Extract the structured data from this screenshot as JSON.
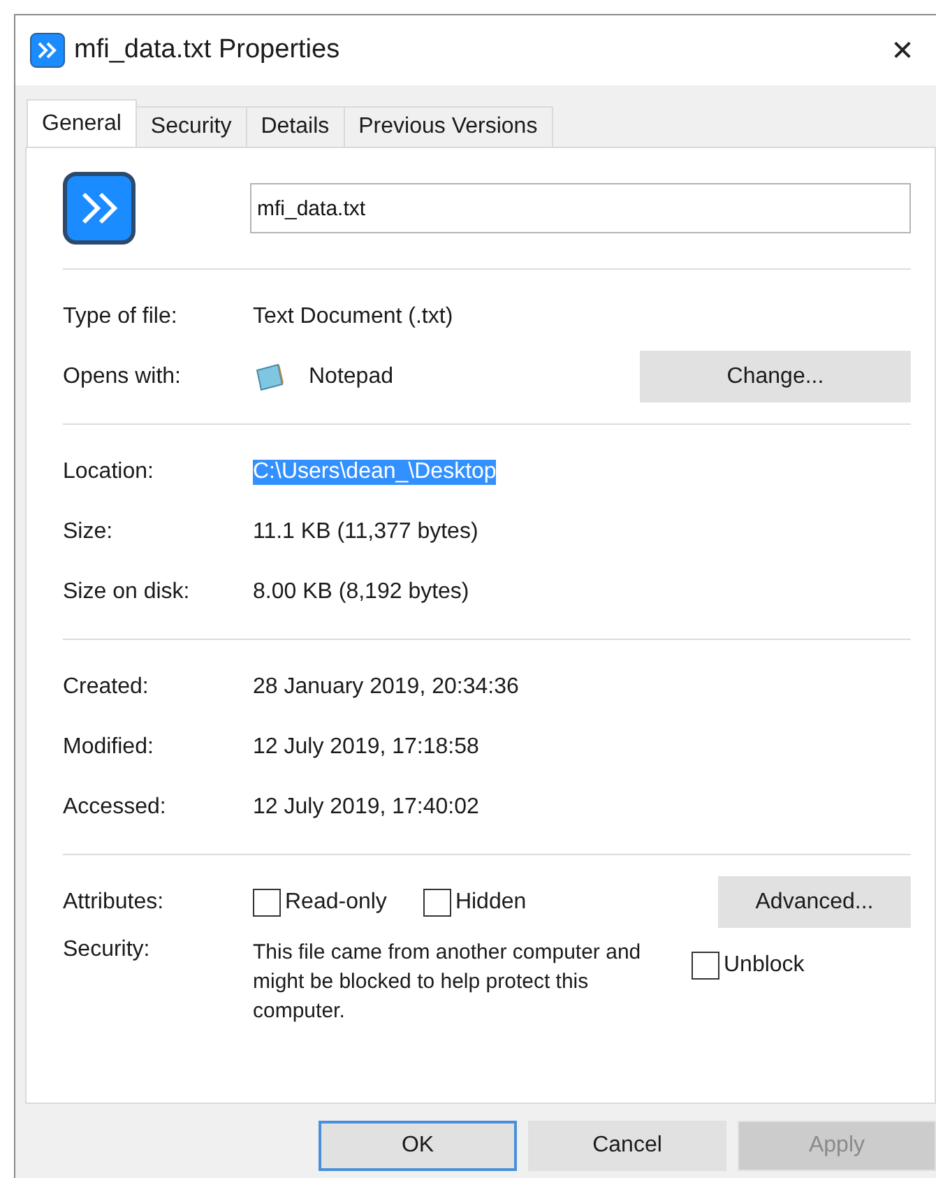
{
  "window": {
    "title": "mfi_data.txt Properties",
    "close": "✕"
  },
  "tabs": [
    {
      "label": "General",
      "selected": true
    },
    {
      "label": "Security",
      "selected": false
    },
    {
      "label": "Details",
      "selected": false
    },
    {
      "label": "Previous Versions",
      "selected": false
    }
  ],
  "file_name": {
    "value": "mfi_data.txt"
  },
  "type_section": [
    {
      "label": "Type of file:",
      "value": "Text Document (.txt)"
    },
    {
      "label": "Opens with:",
      "value": "Notepad",
      "app_icon": true,
      "button": "Change..."
    }
  ],
  "location_section": [
    {
      "label": "Location:",
      "value": "C:\\Users\\dean_\\Desktop",
      "selected": true
    },
    {
      "label": "Size:",
      "value": "11.1 KB (11,377 bytes)",
      "selected": false
    },
    {
      "label": "Size on disk:",
      "value": "8.00 KB (8,192 bytes)",
      "selected": false
    }
  ],
  "date_section": [
    {
      "label": "Created:",
      "value": "28 January 2019, 20:34:36"
    },
    {
      "label": "Modified:",
      "value": "12 July 2019, 17:18:58"
    },
    {
      "label": "Accessed:",
      "value": "12 July 2019, 17:40:02"
    }
  ],
  "attributes": {
    "label": "Attributes:",
    "checkboxes": [
      {
        "label": "Read-only",
        "checked": false
      },
      {
        "label": "Hidden",
        "checked": false
      }
    ],
    "button": "Advanced..."
  },
  "security": {
    "label": "Security:",
    "message": "This file came from another computer and might be blocked to help protect this computer.",
    "unblock": {
      "label": "Unblock",
      "checked": false
    }
  },
  "buttons": [
    {
      "label": "OK",
      "kind": "default",
      "disabled": false
    },
    {
      "label": "Cancel",
      "kind": "normal",
      "disabled": false
    },
    {
      "label": "Apply",
      "kind": "normal",
      "disabled": true
    }
  ]
}
